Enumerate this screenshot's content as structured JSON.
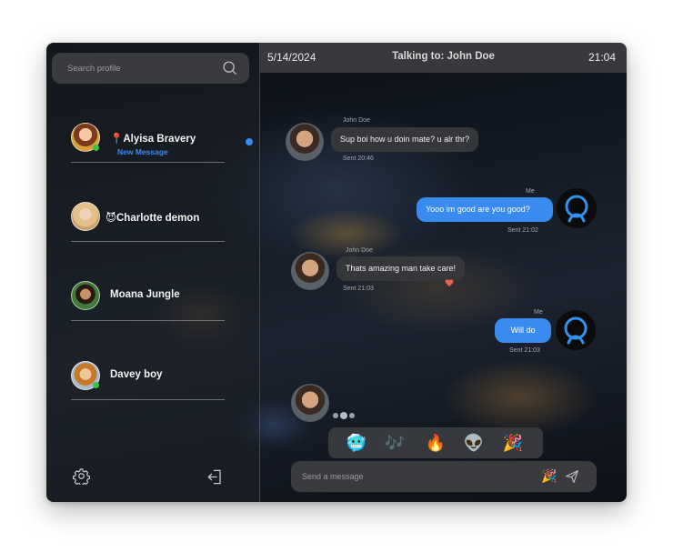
{
  "sidebar": {
    "search_placeholder": "Search profile",
    "contacts": [
      {
        "name": "📍Alyisa Bravery",
        "subtext": "New Message",
        "online": true,
        "unread": true
      },
      {
        "name": "😈Charlotte demon",
        "online": false
      },
      {
        "name": "Moana Jungle",
        "online": false
      },
      {
        "name": "Davey boy",
        "online": true
      }
    ],
    "settings_icon": "gear-icon",
    "logout_icon": "logout-icon"
  },
  "header": {
    "date": "5/14/2024",
    "title": "Talking to: John Doe",
    "time": "21:04"
  },
  "messages": [
    {
      "from": "John Doe",
      "text": "Sup boi how u doin mate? u alr thr?",
      "sent": "Sent 20:46",
      "direction": "in"
    },
    {
      "from": "Me",
      "text": "Yooo im good are you good?",
      "sent": "Sent 21:02",
      "direction": "out"
    },
    {
      "from": "John Doe",
      "text": "Thats amazing man take care!",
      "sent": "Sent 21:03",
      "direction": "in",
      "reaction": "heart"
    },
    {
      "from": "Me",
      "text": "Will do",
      "sent": "Sent 21:03",
      "direction": "out"
    }
  ],
  "reactions": [
    "🥶",
    "🎶",
    "🔥",
    "👽",
    "🎉"
  ],
  "composer": {
    "placeholder": "Send a message",
    "emoji": "🎉"
  },
  "colors": {
    "accent": "#3a8bef",
    "online": "#3bc14a",
    "bubble_in": "#35373b",
    "heart": "#e8614d"
  }
}
